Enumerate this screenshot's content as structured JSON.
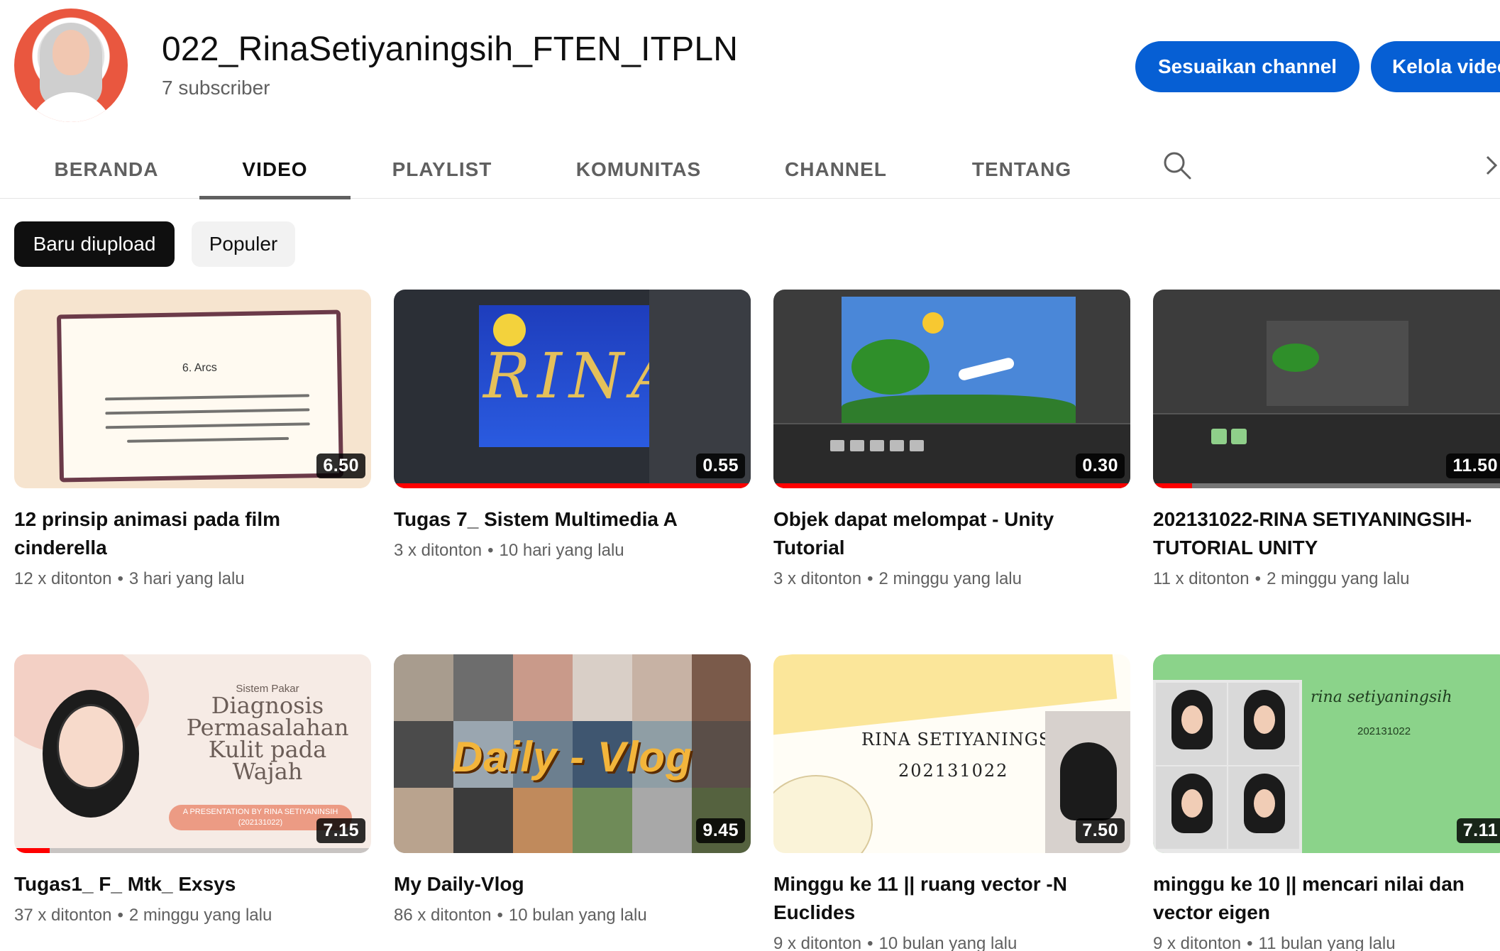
{
  "channel": {
    "name": "022_RinaSetiyaningsih_FTEN_ITPLN",
    "subscribers": "7 subscriber",
    "customize_label": "Sesuaikan channel",
    "manage_label": "Kelola video"
  },
  "tabs": [
    "BERANDA",
    "VIDEO",
    "PLAYLIST",
    "KOMUNITAS",
    "CHANNEL",
    "TENTANG"
  ],
  "active_tab": "VIDEO",
  "chips": [
    "Baru diupload",
    "Populer"
  ],
  "icons": {
    "search": "search-icon",
    "next": "chevron-right-icon"
  },
  "colors": {
    "accent": "#065fd4",
    "progress": "#ff0000"
  },
  "videos": [
    {
      "title": "12 prinsip animasi pada film cinderella",
      "views": "12 x ditonton",
      "age": "3 hari yang lalu",
      "duration": "6.50",
      "watched": 0
    },
    {
      "title": "Tugas 7_ Sistem Multimedia A",
      "views": "3 x ditonton",
      "age": "10 hari yang lalu",
      "duration": "0.55",
      "watched": 1.0
    },
    {
      "title": "Objek dapat melompat - Unity Tutorial",
      "views": "3 x ditonton",
      "age": "2 minggu yang lalu",
      "duration": "0.30",
      "watched": 1.0
    },
    {
      "title": "202131022-RINA SETIYANINGSIH-TUTORIAL UNITY",
      "views": "11 x ditonton",
      "age": "2 minggu yang lalu",
      "duration": "11.50",
      "watched": 0.11
    },
    {
      "title": "Tugas1_ F_ Mtk_ Exsys",
      "views": "37 x ditonton",
      "age": "2 minggu yang lalu",
      "duration": "7.15",
      "watched": 0.1
    },
    {
      "title": "My Daily-Vlog",
      "views": "86 x ditonton",
      "age": "10 bulan yang lalu",
      "duration": "9.45",
      "watched": 0
    },
    {
      "title": "Minggu ke 11 || ruang vector -N Euclides",
      "views": "9 x ditonton",
      "age": "10 bulan yang lalu",
      "duration": "7.50",
      "watched": 0
    },
    {
      "title": "minggu ke 10 || mencari nilai dan vector eigen",
      "views": "9 x ditonton",
      "age": "11 bulan yang lalu",
      "duration": "7.11",
      "watched": 0
    }
  ],
  "thumb_text": {
    "v1_heading": "6. Arcs",
    "v2_word": "RINA",
    "v5_small": "Sistem Pakar",
    "v5_big": "Diagnosis Permasalahan Kulit pada Wajah",
    "v5_badge": "A PRESENTATION BY RINA SETIYANINSIH (202131022)",
    "v6_logo": "Daily - Vlog",
    "v7_name": "RINA SETIYANINGSIH",
    "v7_nim": "202131022",
    "v8_name": "rina setiyaningsih",
    "v8_nim": "202131022"
  }
}
